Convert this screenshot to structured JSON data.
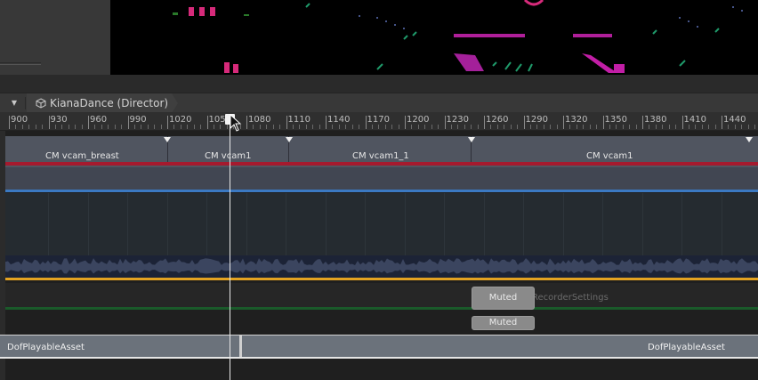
{
  "director": {
    "breadcrumb_label": "KianaDance (Director)",
    "dropdown_icon": "dropdown-triangle-icon",
    "object_icon": "cube-icon"
  },
  "ruler": {
    "ticks": [
      "900",
      "930",
      "960",
      "990",
      "1020",
      "1050",
      "1080",
      "1110",
      "1140",
      "1170",
      "1200",
      "1230",
      "1260",
      "1290",
      "1320",
      "1350",
      "1380",
      "1410",
      "1440"
    ],
    "playhead_frame": 1058
  },
  "tracks": {
    "camera_clips": [
      "CM vcam_breast",
      "CM vcam1",
      "CM vcam1_1",
      "CM vcam1"
    ],
    "recorder": {
      "muted_label_1": "Muted",
      "ghost_text": "RecorderSettings",
      "muted_label_2": "Muted"
    },
    "dof_clips": [
      "DofPlayableAsset",
      "DofPlayableAsset"
    ]
  },
  "colors": {
    "camera_track_line": "#a51a2e",
    "blue_track_line": "#3b79c2",
    "audio_track_line": "#e3a221",
    "recorder_track_line": "#1a5a2a"
  }
}
